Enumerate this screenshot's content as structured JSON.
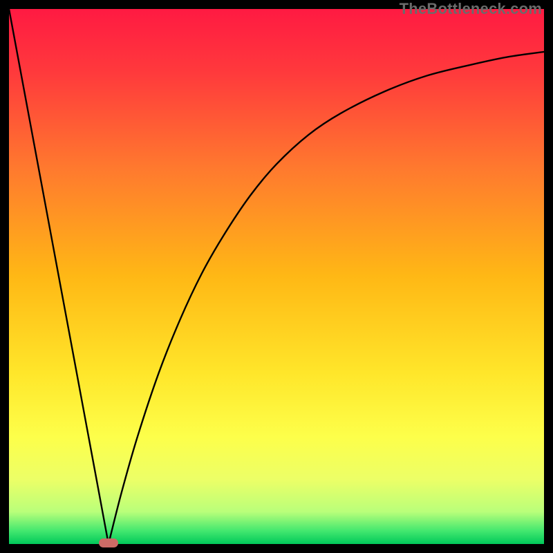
{
  "watermark": {
    "text": "TheBottleneck.com"
  },
  "gradient": {
    "stops": [
      {
        "offset": 0.0,
        "color": "#ff1a42"
      },
      {
        "offset": 0.12,
        "color": "#ff3a3c"
      },
      {
        "offset": 0.3,
        "color": "#ff7a2e"
      },
      {
        "offset": 0.5,
        "color": "#ffb815"
      },
      {
        "offset": 0.68,
        "color": "#ffe62a"
      },
      {
        "offset": 0.8,
        "color": "#fdff4a"
      },
      {
        "offset": 0.88,
        "color": "#ecff67"
      },
      {
        "offset": 0.94,
        "color": "#b9ff7a"
      },
      {
        "offset": 0.975,
        "color": "#44e86f"
      },
      {
        "offset": 1.0,
        "color": "#00c95a"
      }
    ]
  },
  "marker": {
    "x_frac": 0.186,
    "color": "#cc6b66"
  },
  "chart_data": {
    "type": "line",
    "title": "",
    "xlabel": "",
    "ylabel": "",
    "xlim": [
      0,
      1
    ],
    "ylim": [
      0,
      1
    ],
    "note": "Bottleneck-style V-curve. y is a mismatch metric (0 = best, 1 = worst). Minimum at x≈0.186. Left branch rises steeply to 1 at x=0; right branch rises concavely toward ~0.92 at x=1.",
    "series": [
      {
        "name": "left-branch",
        "x": [
          0.0,
          0.04,
          0.08,
          0.12,
          0.16,
          0.186
        ],
        "values": [
          1.0,
          0.785,
          0.57,
          0.355,
          0.14,
          0.0
        ]
      },
      {
        "name": "right-branch",
        "x": [
          0.186,
          0.21,
          0.24,
          0.28,
          0.32,
          0.36,
          0.4,
          0.45,
          0.5,
          0.56,
          0.62,
          0.7,
          0.78,
          0.86,
          0.93,
          1.0
        ],
        "values": [
          0.0,
          0.095,
          0.2,
          0.32,
          0.42,
          0.505,
          0.575,
          0.65,
          0.71,
          0.765,
          0.805,
          0.845,
          0.875,
          0.895,
          0.91,
          0.92
        ]
      }
    ]
  }
}
